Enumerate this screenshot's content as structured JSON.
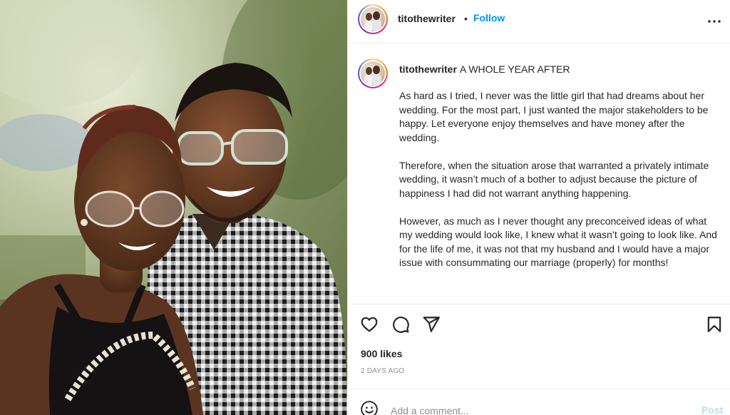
{
  "post": {
    "username": "titothewriter",
    "follow_label": "Follow",
    "separator": "•",
    "more_icon": "more-horizontal-icon",
    "caption": {
      "title": "A WHOLE YEAR AFTER",
      "paragraphs": [
        "As hard as I tried, I never was the little girl that had dreams about her wedding. For the most part, I just wanted the major stakeholders to be happy. Let everyone enjoy themselves and have money after the wedding.",
        "Therefore, when the situation arose that warranted a privately intimate wedding, it wasn’t much of a bother to adjust because the picture of happiness I had did not warrant anything happening.",
        "However, as much as I never thought any preconceived ideas of what my wedding would look like, I knew what it wasn’t going to look like. And for the life of me, it was not that my husband and I would have a major issue with consummating our marriage (properly) for months!"
      ]
    },
    "actions": {
      "like_icon": "heart-icon",
      "comment_icon": "comment-bubble-icon",
      "share_icon": "paper-plane-icon",
      "save_icon": "bookmark-icon"
    },
    "likes": "900 likes",
    "timestamp": "2 DAYS AGO",
    "comment_box": {
      "placeholder": "Add a comment...",
      "post_label": "Post",
      "emoji_icon": "emoji-smile-icon"
    }
  },
  "colors": {
    "link_blue": "#0095f6",
    "post_disabled": "#b2dffc",
    "text": "#262626",
    "muted": "#8e8e8e",
    "divider": "#efefef"
  }
}
